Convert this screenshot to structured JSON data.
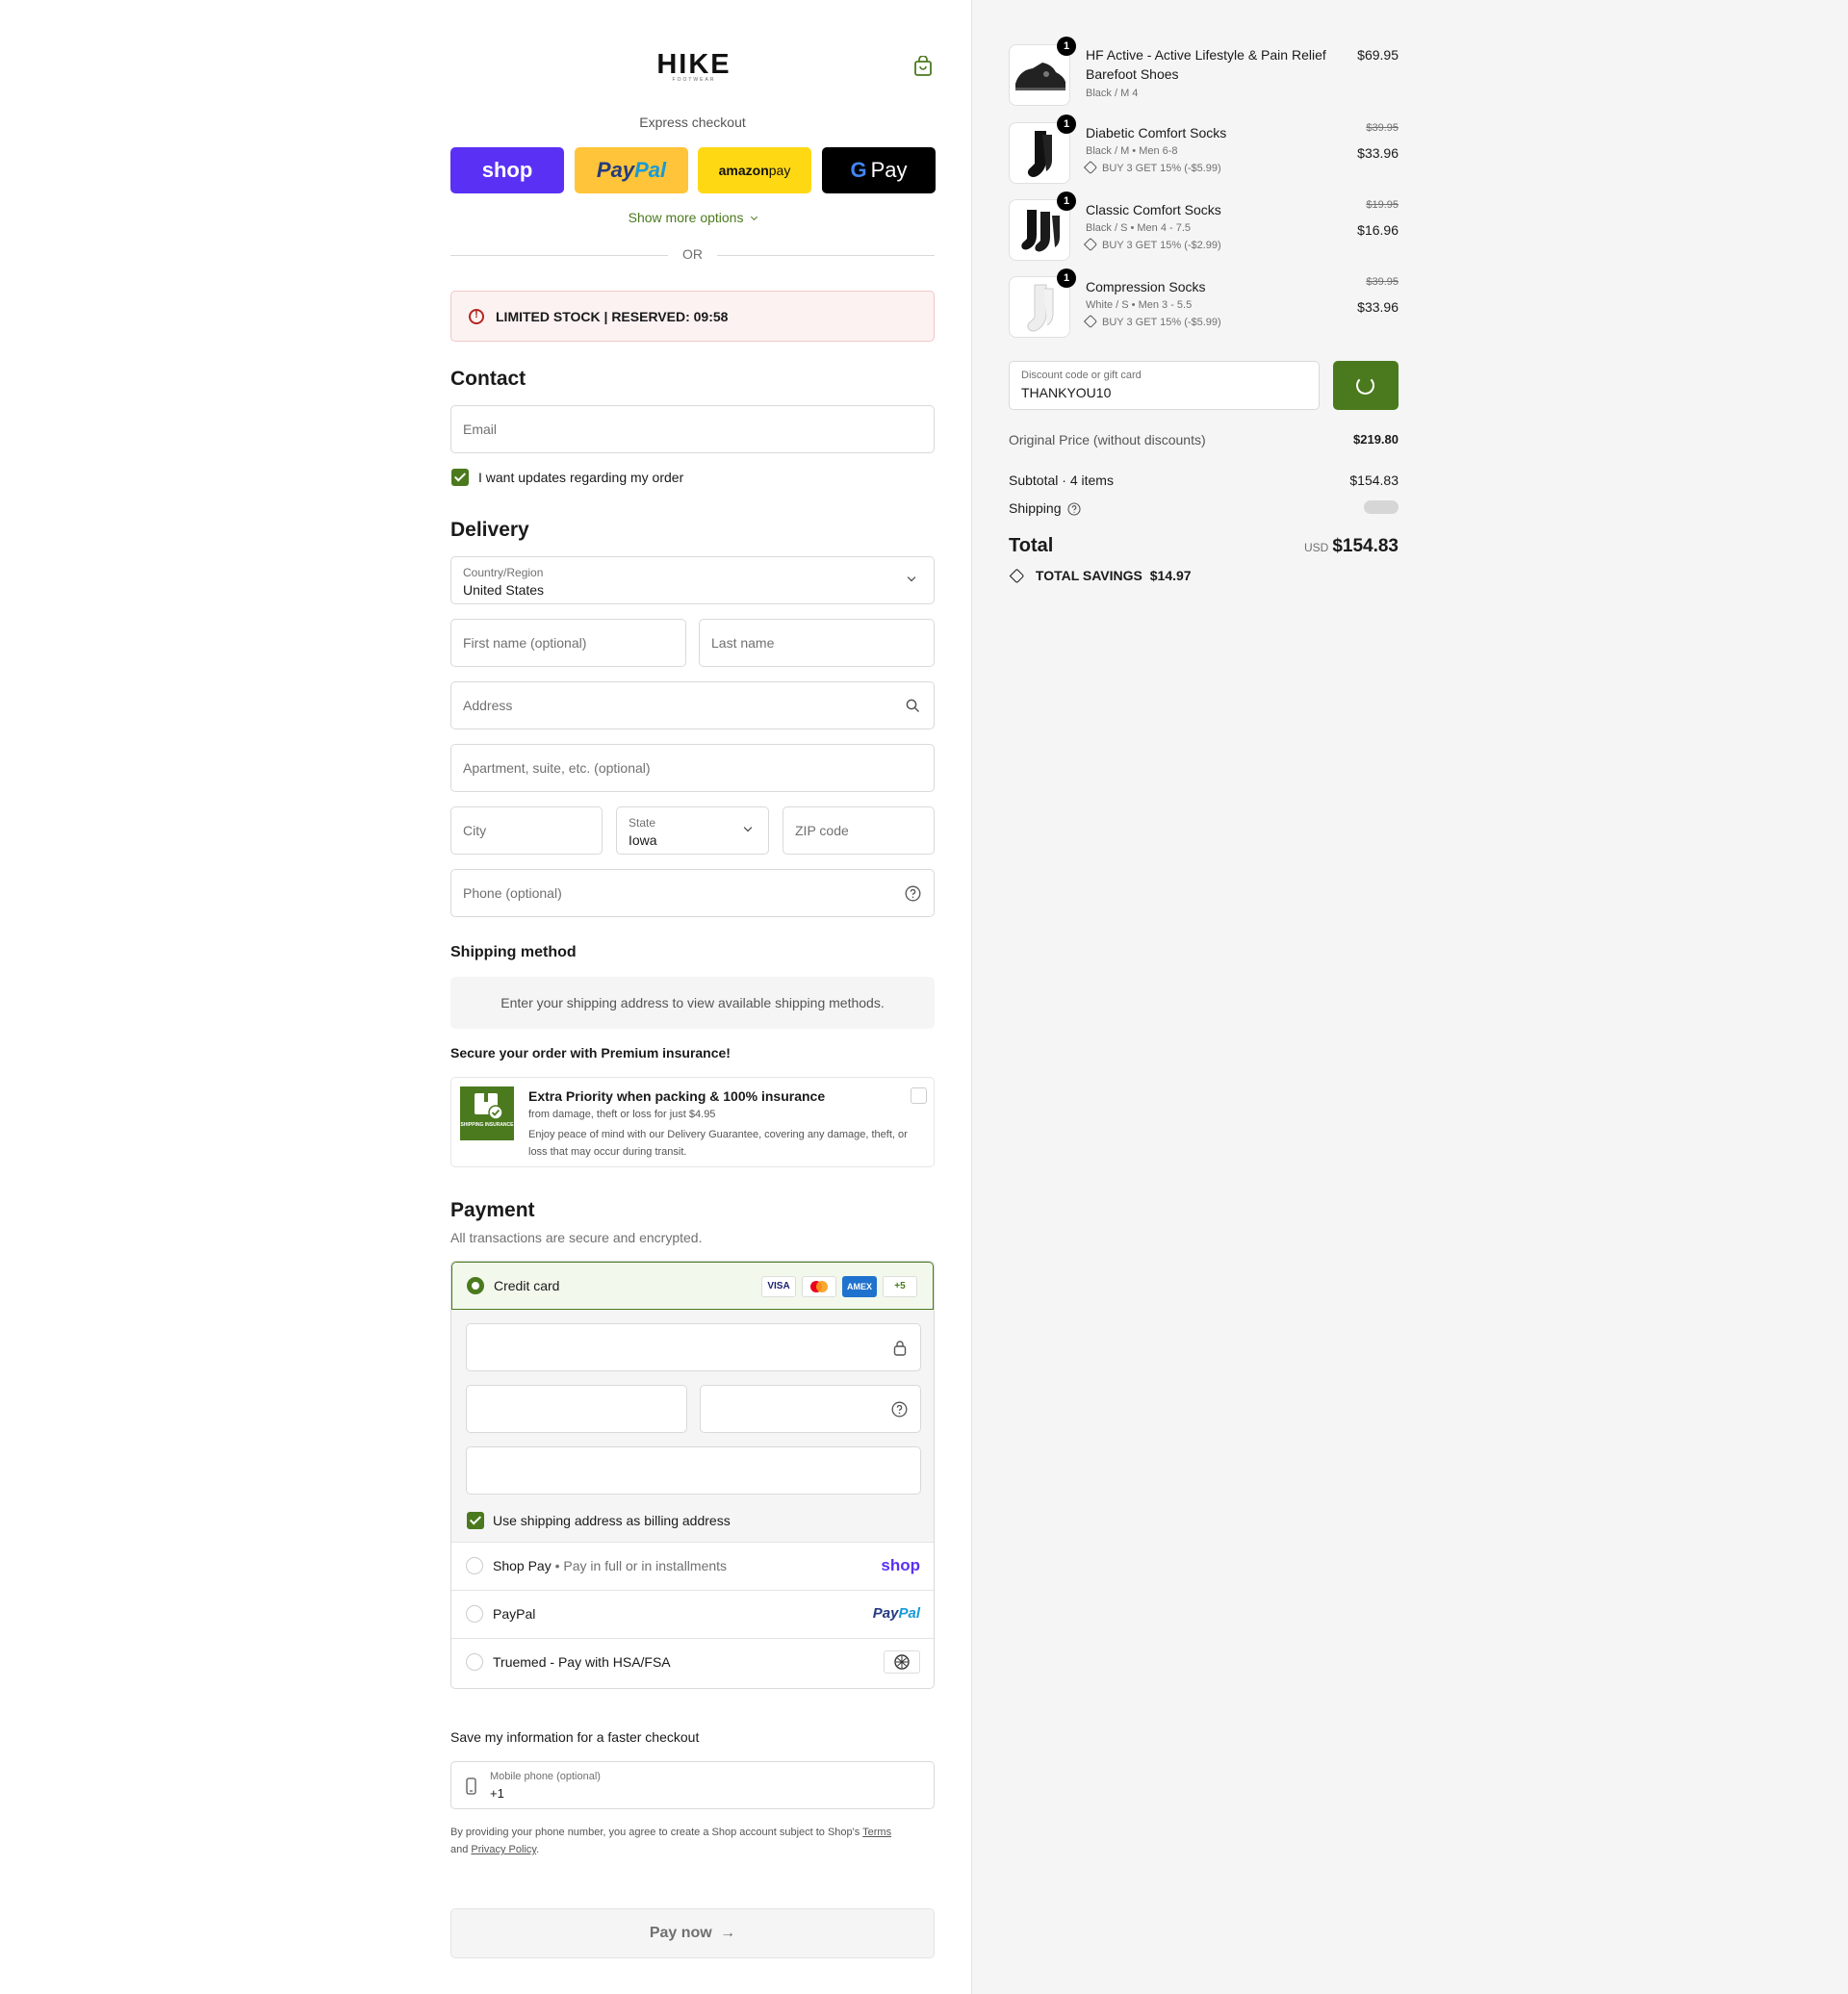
{
  "brand": {
    "logo": "HIKE",
    "logo_sub": "FOOTWEAR"
  },
  "express": {
    "title": "Express checkout",
    "shop": "shop",
    "paypal_a": "Pay",
    "paypal_b": "Pal",
    "amazon_a": "amazon",
    "amazon_b": " pay",
    "gpay_g": "G",
    "gpay_label": "Pay",
    "show_more": "Show more options",
    "or": "OR"
  },
  "stock_banner": "LIMITED STOCK | RESERVED: 09:58",
  "contact": {
    "title": "Contact",
    "email_placeholder": "Email",
    "updates_label": "I want updates regarding my order"
  },
  "delivery": {
    "title": "Delivery",
    "country_label": "Country/Region",
    "country_value": "United States",
    "first_name": "First name (optional)",
    "last_name": "Last name",
    "address": "Address",
    "apartment": "Apartment, suite, etc. (optional)",
    "city": "City",
    "state_label": "State",
    "state_value": "Iowa",
    "zip": "ZIP code",
    "phone": "Phone (optional)"
  },
  "shipping": {
    "title": "Shipping method",
    "message": "Enter your shipping address to view available shipping methods."
  },
  "insurance": {
    "heading": "Secure your order with Premium insurance!",
    "badge_text": "SHIPPING INSURANCE",
    "title": "Extra Priority when packing & 100% insurance",
    "line1": "from damage, theft or loss for just $4.95",
    "line2": "Enjoy peace of mind with our Delivery Guarantee, covering any damage, theft, or loss that may occur during transit."
  },
  "payment": {
    "title": "Payment",
    "subtitle": "All transactions are secure and encrypted.",
    "credit_card": "Credit card",
    "brands": [
      "VISA",
      "",
      "AMEX",
      "+5"
    ],
    "billing_label": "Use shipping address as billing address",
    "shop_pay": "Shop Pay",
    "shop_pay_sub": "Pay in full or in installments",
    "shop_logo": "shop",
    "paypal": "PayPal",
    "paypal_logo_a": "Pay",
    "paypal_logo_b": "Pal",
    "truemed": "Truemed - Pay with HSA/FSA"
  },
  "save_info": {
    "title": "Save my information for a faster checkout",
    "mobile_label": "Mobile phone (optional)",
    "mobile_value": "+1",
    "terms_a": "By providing your phone number, you agree to create a Shop account subject to Shop's ",
    "terms_link": "Terms",
    "terms_b": "and ",
    "privacy_link": "Privacy Policy",
    "terms_c": "."
  },
  "pay_now": "Pay now",
  "order": {
    "items": [
      {
        "qty": "1",
        "name": "HF Active - Active Lifestyle & Pain Relief Barefoot Shoes",
        "variant": "Black / M 4",
        "discount": "",
        "old_price": "",
        "price": "$69.95"
      },
      {
        "qty": "1",
        "name": "Diabetic Comfort Socks",
        "variant": "Black / M • Men 6-8",
        "discount": "BUY 3 GET 15% (-$5.99)",
        "old_price": "$39.95",
        "price": "$33.96"
      },
      {
        "qty": "1",
        "name": "Classic Comfort Socks",
        "variant": "Black / S • Men 4 - 7.5",
        "discount": "BUY 3 GET 15% (-$2.99)",
        "old_price": "$19.95",
        "price": "$16.96"
      },
      {
        "qty": "1",
        "name": "Compression Socks",
        "variant": "White / S • Men 3 - 5.5",
        "discount": "BUY 3 GET 15% (-$5.99)",
        "old_price": "$39.95",
        "price": "$33.96"
      }
    ],
    "discount_label": "Discount code or gift card",
    "discount_value": "THANKYOU10",
    "original_label": "Original Price (without discounts)",
    "original_value": "$219.80",
    "subtotal_label": "Subtotal · 4 items",
    "subtotal_value": "$154.83",
    "shipping_label": "Shipping",
    "total_label": "Total",
    "currency": "USD",
    "total_value": "$154.83",
    "savings_label": "TOTAL SAVINGS",
    "savings_value": "$14.97"
  },
  "colors": {
    "accent": "#4b7a1e",
    "shop_purple": "#5a31f4",
    "paypal_yellow": "#ffc439",
    "amazon_yellow": "#ffd814"
  }
}
